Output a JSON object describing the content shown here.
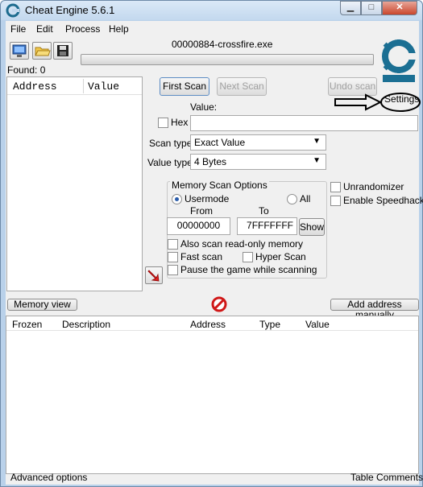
{
  "window": {
    "title": "Cheat Engine 5.6.1",
    "minimize": "▁",
    "maximize": "□",
    "close": "✕"
  },
  "menu": [
    "File",
    "Edit",
    "Process",
    "Help"
  ],
  "process": {
    "name": "00000884-crossfire.exe"
  },
  "found": "Found: 0",
  "results_table": {
    "headers": [
      "Address",
      "Value"
    ]
  },
  "scan_buttons": {
    "first": "First Scan",
    "next": "Next Scan",
    "undo": "Undo scan"
  },
  "settings_label": "Settings",
  "value": {
    "label": "Value:",
    "hex_label": "Hex",
    "current": ""
  },
  "scan_type": {
    "label": "Scan type",
    "selected": "Exact Value"
  },
  "value_type": {
    "label": "Value type",
    "selected": "4 Bytes"
  },
  "memory_options": {
    "title": "Memory Scan Options",
    "usermode": "Usermode",
    "all": "All",
    "from_label": "From",
    "to_label": "To",
    "from_value": "00000000",
    "to_value": "7FFFFFFF",
    "show": "Show",
    "readonly": "Also scan read-only memory",
    "fast": "Fast scan",
    "hyper": "Hyper Scan",
    "pause": "Pause the game while scanning"
  },
  "options": {
    "unrandomizer": "Unrandomizer",
    "speedhack": "Enable Speedhack"
  },
  "bottom_buttons": {
    "memory_view": "Memory view",
    "add_address": "Add address manually"
  },
  "address_table": {
    "headers": [
      "Frozen",
      "Description",
      "Address",
      "Type",
      "Value"
    ]
  },
  "status": {
    "left": "Advanced options",
    "right": "Table Comments"
  },
  "icons": {
    "open_process": "computer-icon",
    "open_file": "folder-icon",
    "save": "floppy-disk-icon",
    "logo": "cheat-engine-logo",
    "clear": "no-entry-icon",
    "arrow": "red-arrow-icon"
  }
}
